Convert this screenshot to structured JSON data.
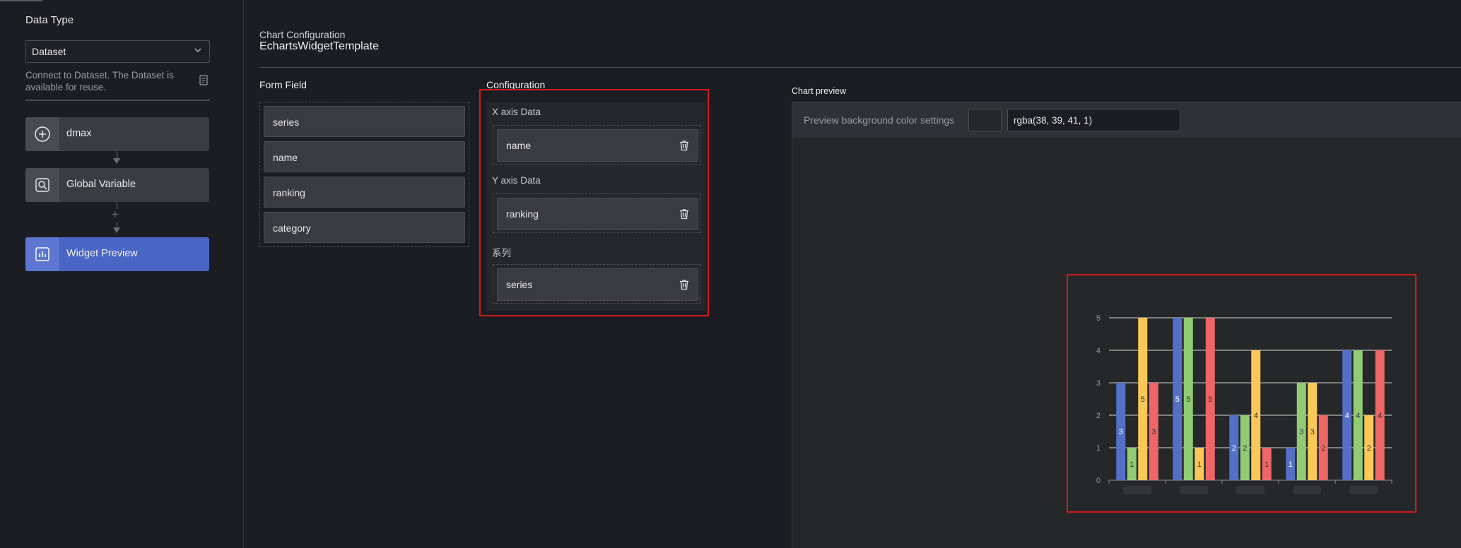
{
  "left_panel": {
    "data_type_label": "Data Type",
    "data_type_value": "Dataset",
    "description": "Connect to Dataset. The Dataset is available for reuse.",
    "nodes": [
      {
        "label": "dmax",
        "icon": "plus-circle-icon"
      },
      {
        "label": "Global Variable",
        "icon": "variable-icon"
      },
      {
        "label": "Widget Preview",
        "icon": "chart-icon"
      }
    ],
    "add_symbol": "+"
  },
  "header": {
    "label": "Chart Configuration",
    "title": "EchartsWidgetTemplate"
  },
  "form_field": {
    "label": "Form Field",
    "items": [
      "series",
      "name",
      "ranking",
      "category"
    ]
  },
  "configuration": {
    "label": "Configuration",
    "sections": [
      {
        "label": "X axis Data",
        "field": "name"
      },
      {
        "label": "Y axis Data",
        "field": "ranking"
      },
      {
        "label": "系列",
        "field": "series"
      }
    ]
  },
  "chart_preview": {
    "label": "Chart preview",
    "bg_label": "Preview background color settings",
    "bg_value": "rgba(38, 39, 41, 1)"
  },
  "colors": {
    "accent": "#4a66c4",
    "highlight": "#d11a1a",
    "series": [
      "#5470c6",
      "#91cc75",
      "#fac858",
      "#ee6666"
    ]
  },
  "chart_data": {
    "type": "bar",
    "ylim": [
      0,
      5
    ],
    "yticks": [
      0,
      1,
      2,
      3,
      4,
      5
    ],
    "categories": [
      "",
      "",
      "",
      "",
      ""
    ],
    "series": [
      {
        "values": [
          3,
          5,
          2,
          1,
          4
        ]
      },
      {
        "values": [
          1,
          5,
          2,
          3,
          4
        ]
      },
      {
        "values": [
          5,
          1,
          4,
          3,
          2
        ]
      },
      {
        "values": [
          3,
          5,
          1,
          2,
          4
        ]
      }
    ],
    "data_labels": true,
    "grid": true
  }
}
